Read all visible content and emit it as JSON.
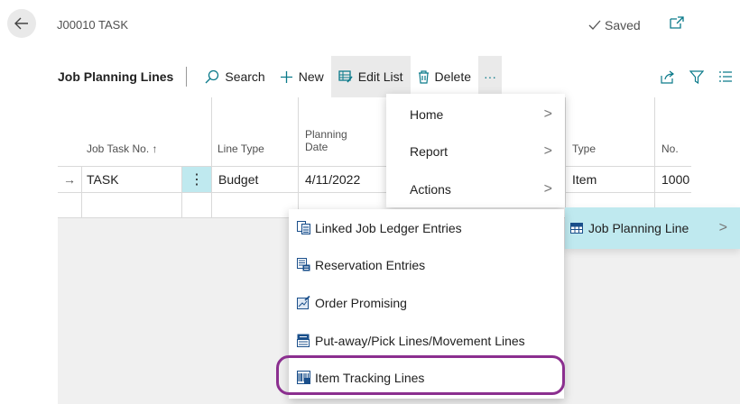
{
  "header": {
    "title": "J00010 TASK",
    "saved_label": "Saved"
  },
  "actionbar": {
    "title": "Job Planning Lines",
    "search_label": "Search",
    "new_label": "New",
    "edit_list_label": "Edit List",
    "delete_label": "Delete",
    "more_label": "···"
  },
  "grid": {
    "columns": {
      "job_task_no": "Job Task No. ↑",
      "line_type": "Line Type",
      "planning_date_line1": "Planning",
      "planning_date_line2": "Date",
      "type": "Type",
      "no": "No."
    },
    "row1": {
      "arrow": "→",
      "job_task_no": "TASK",
      "menu": "⋮",
      "line_type": "Budget",
      "planning_date": "4/11/2022",
      "type": "Item",
      "no": "1000"
    }
  },
  "menu_primary": [
    {
      "label": "Home"
    },
    {
      "label": "Report"
    },
    {
      "label": "Actions"
    }
  ],
  "submenu_active": {
    "label": "Job Planning Line"
  },
  "menu_secondary": [
    {
      "label": "Linked Job Ledger Entries",
      "icon": "ledger-entries-icon"
    },
    {
      "label": "Reservation Entries",
      "icon": "reservation-icon"
    },
    {
      "label": "Order Promising",
      "icon": "order-promising-icon"
    },
    {
      "label": "Put-away/Pick Lines/Movement Lines",
      "icon": "warehouse-lines-icon"
    },
    {
      "label": "Item Tracking Lines",
      "icon": "item-tracking-icon"
    }
  ],
  "colors": {
    "accent": "#0b7a8a",
    "highlight": "#bfe9ef",
    "ring": "#8b2f8f"
  }
}
